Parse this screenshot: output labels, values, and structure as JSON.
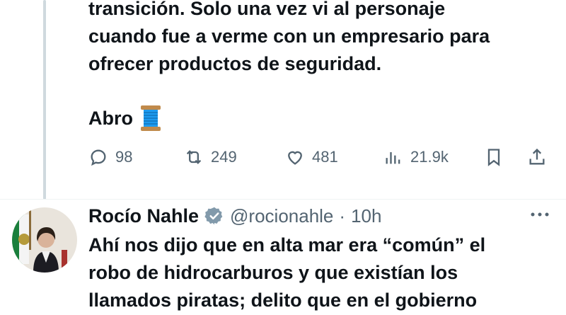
{
  "tweet1": {
    "lines": [
      "transición. Solo una vez vi al personaje",
      "cuando fue a verme con un empresario para",
      "ofrecer productos de seguridad."
    ],
    "abro_text": "Abro",
    "abro_emoji_icon": "thread-spool-icon",
    "actions": {
      "replies": "98",
      "reposts": "249",
      "likes": "481",
      "views": "21.9k"
    }
  },
  "tweet2": {
    "author_name": "Rocío Nahle",
    "handle": "@rocionahle",
    "separator": "·",
    "time": "10h",
    "lines": [
      "Ahí nos dijo que en alta mar era “común” el",
      "robo de hidrocarburos y que existían los",
      "llamados piratas; delito que en el gobierno"
    ]
  },
  "colors": {
    "text": "#0f1419",
    "secondary": "#536471",
    "verified_badge": "#829aab",
    "thread_line": "#cfd9de",
    "spool_blue": "#1d9bf0"
  }
}
